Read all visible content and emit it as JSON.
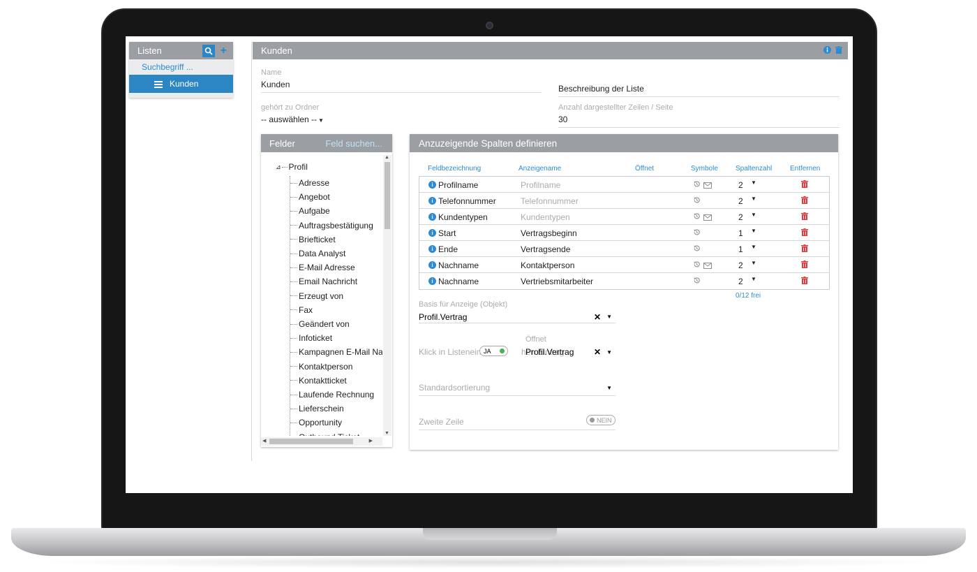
{
  "lists": {
    "title": "Listen",
    "search_term": "Suchbegriff ...",
    "active_item": "Kunden"
  },
  "main": {
    "title": "Kunden",
    "name_label": "Name",
    "name_value": "Kunden",
    "description_placeholder": "Beschreibung der Liste",
    "folder_label": "gehört zu Ordner",
    "folder_value": "-- auswählen --",
    "rows_label": "Anzahl dargestellter Zeilen / Seite",
    "rows_value": "30"
  },
  "felder": {
    "title": "Felder",
    "search_link": "Feld suchen...",
    "root": "Profil",
    "items": [
      "Adresse",
      "Angebot",
      "Aufgabe",
      "Auftragsbestätigung",
      "Briefticket",
      "Data Analyst",
      "E-Mail Adresse",
      "Email Nachricht",
      "Erzeugt von",
      "Fax",
      "Geändert von",
      "Infoticket",
      "Kampagnen E-Mail Nac",
      "Kontaktperson",
      "Kontaktticket",
      "Laufende Rechnung",
      "Lieferschein",
      "Opportunity",
      "Outbound Ticket"
    ]
  },
  "spalten": {
    "title": "Anzuzeigende Spalten definieren",
    "columns": {
      "feldbezeichnung": "Feldbezeichnung",
      "anzeigename": "Anzeigename",
      "oeffnet": "Öffnet",
      "symbole": "Symbole",
      "spaltenzahl": "Spaltenzahl",
      "entfernen": "Entfernen"
    },
    "rows": [
      {
        "field": "Profilname",
        "display": "Profilname",
        "display_placeholder": true,
        "mail": true,
        "count": "2"
      },
      {
        "field": "Telefonnummer",
        "display": "Telefonnummer",
        "display_placeholder": true,
        "mail": false,
        "count": "2"
      },
      {
        "field": "Kundentypen",
        "display": "Kundentypen",
        "display_placeholder": true,
        "mail": true,
        "count": "2"
      },
      {
        "field": "Start",
        "display": "Vertragsbeginn",
        "display_placeholder": false,
        "mail": false,
        "count": "1"
      },
      {
        "field": "Ende",
        "display": "Vertragsende",
        "display_placeholder": false,
        "mail": false,
        "count": "1"
      },
      {
        "field": "Nachname",
        "display": "Kontaktperson",
        "display_placeholder": false,
        "mail": true,
        "count": "2"
      },
      {
        "field": "Nachname",
        "display": "Vertriebsmitarbeiter",
        "display_placeholder": false,
        "mail": false,
        "count": "2"
      }
    ],
    "free": "0/12 frei",
    "basis_label": "Basis für Anzeige (Objekt)",
    "basis_value": "Profil.Vertrag",
    "click_label_left": "Klick in Listenein",
    "click_label_right": "hen Eintrag",
    "click_toggle": "JA",
    "oeffnet_label": "Öffnet",
    "oeffnet_value": "Profil.Vertrag",
    "sort_label": "Standardsortierung",
    "second_row_label": "Zweite Zeile",
    "second_row_toggle": "NEIN"
  },
  "colors": {
    "accent": "#2e8bd0",
    "header_gray": "#9b9fa3",
    "delete_red": "#e0393e",
    "toggle_green": "#4caf50"
  }
}
